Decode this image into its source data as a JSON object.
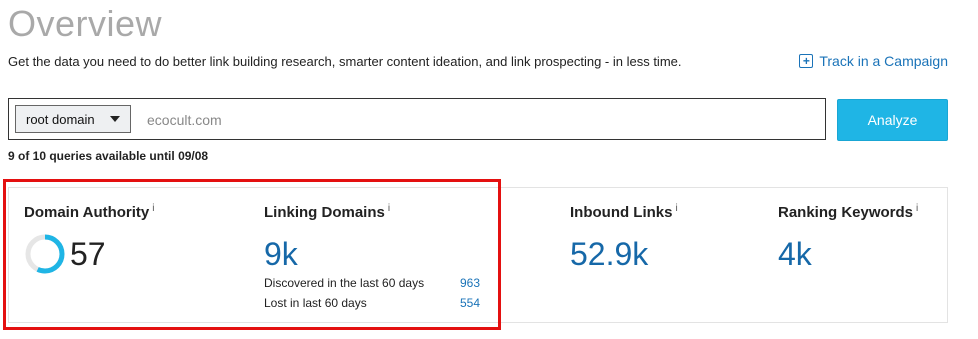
{
  "header": {
    "title": "Overview",
    "subtitle": "Get the data you need to do better link building research, smarter content ideation, and link prospecting - in less time.",
    "track_link": "Track in a Campaign"
  },
  "search": {
    "scope_selected": "root domain",
    "value": "ecocult.com",
    "analyze_label": "Analyze",
    "queries_available": "9 of 10 queries available until 09/08"
  },
  "metrics": {
    "domain_authority": {
      "label": "Domain Authority",
      "value": "57",
      "progress": 0.57
    },
    "linking_domains": {
      "label": "Linking Domains",
      "value": "9k",
      "discovered_label": "Discovered in the last 60 days",
      "discovered_value": "963",
      "lost_label": "Lost in last 60 days",
      "lost_value": "554"
    },
    "inbound_links": {
      "label": "Inbound Links",
      "value": "52.9k"
    },
    "ranking_keywords": {
      "label": "Ranking Keywords",
      "value": "4k"
    },
    "info_glyph": "i"
  },
  "colors": {
    "accent_blue": "#1668a8",
    "button_blue": "#1fb5e5",
    "highlight_red": "#e41010",
    "ring_blue": "#1fb5e5"
  }
}
